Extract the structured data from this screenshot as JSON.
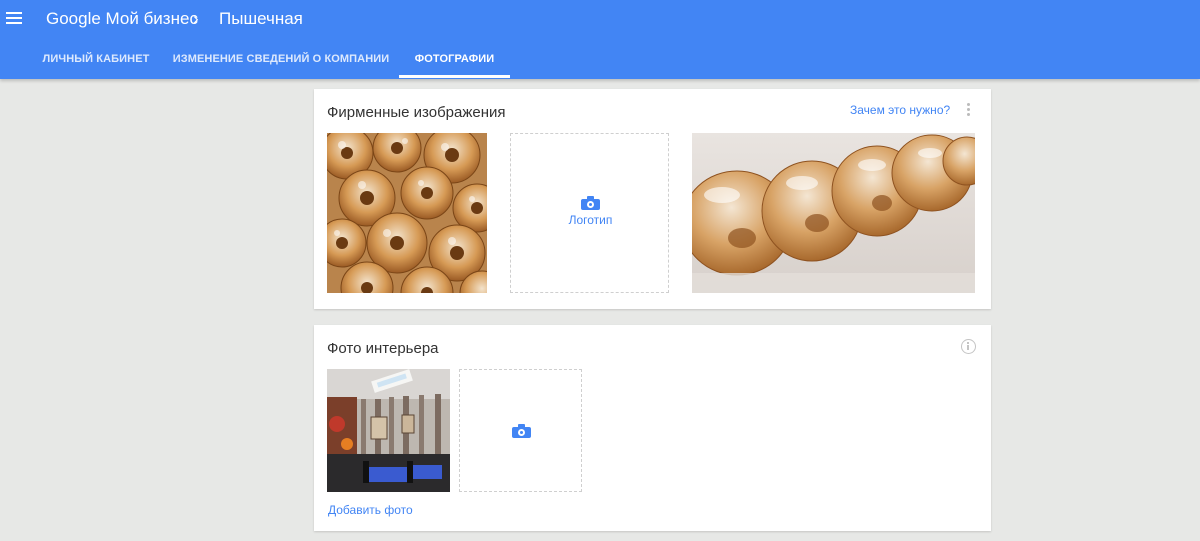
{
  "header": {
    "brand": "Google Мой бизнес",
    "separator": "›",
    "business_name": "Пышечная",
    "menu_icon": "hamburger-menu-icon"
  },
  "tabs": [
    {
      "label": "ЛИЧНЫЙ КАБИНЕТ",
      "active": false
    },
    {
      "label": "ИЗМЕНЕНИЕ СВЕДЕНИЙ О КОМПАНИИ",
      "active": false
    },
    {
      "label": "ФОТОГРАФИИ",
      "active": true
    }
  ],
  "brand_images": {
    "title": "Фирменные изображения",
    "why_link": "Зачем это нужно?",
    "logo_label": "Логотип",
    "icons": [
      "camera-icon",
      "more-vert-icon"
    ]
  },
  "interior": {
    "title": "Фото интерьера",
    "add_photo": "Добавить фото",
    "icons": [
      "info-icon",
      "camera-icon"
    ]
  },
  "colors": {
    "appbar": "#4285f4",
    "link": "#4285f4",
    "background": "#e7e8e6"
  }
}
